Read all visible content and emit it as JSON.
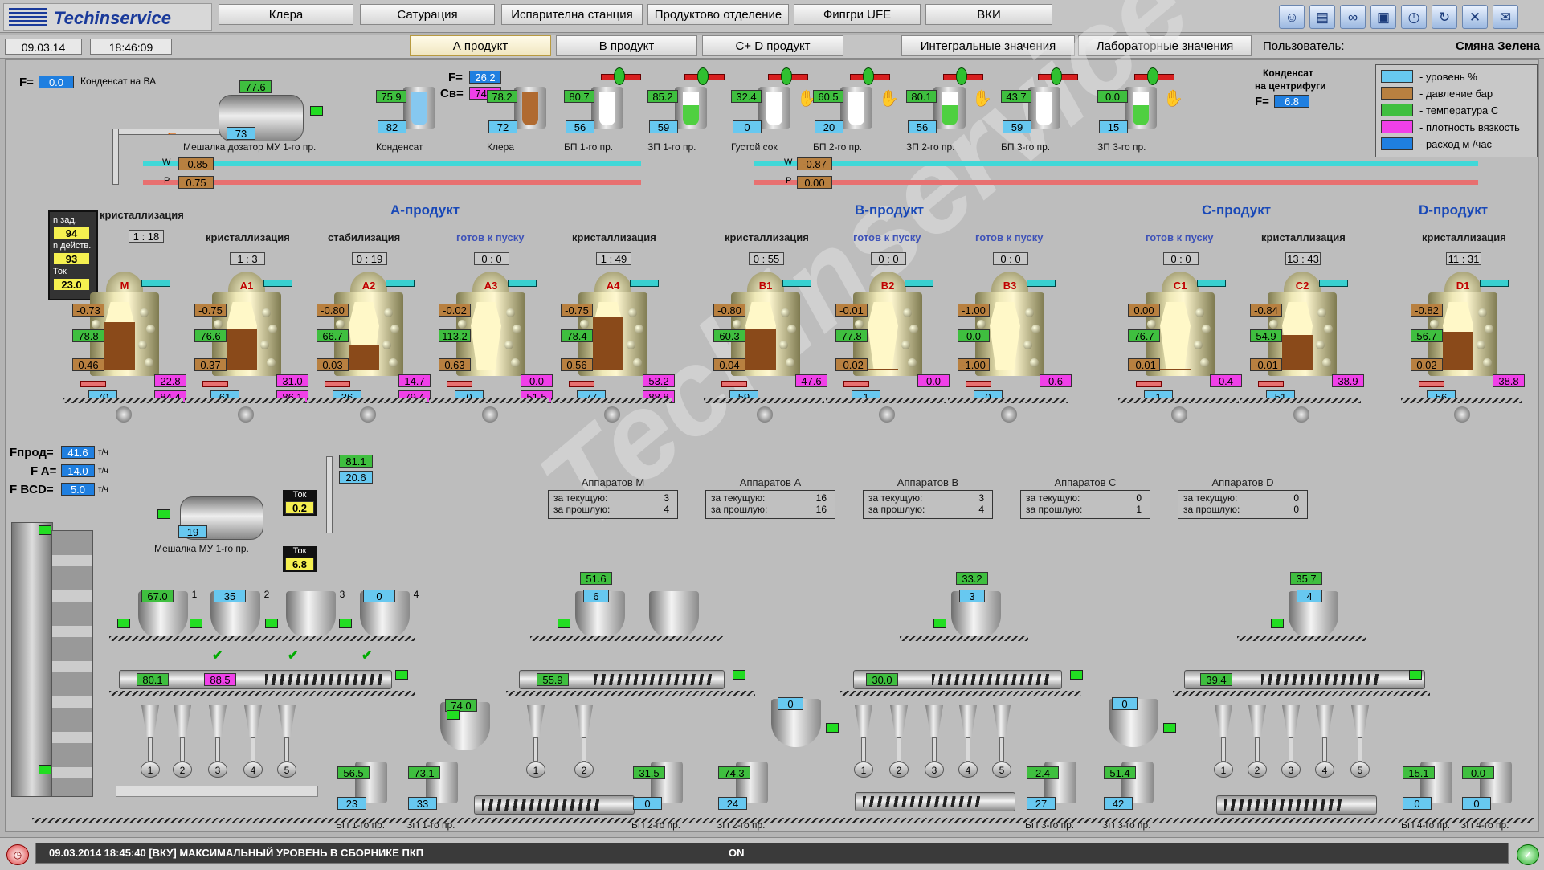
{
  "app": {
    "logo": "Techinservice",
    "watermark": "Techinservice"
  },
  "nav": {
    "row1": [
      "Клера",
      "Сатурация",
      "Испарителна станция",
      "Продуктово отделение",
      "Фипгри UFE",
      "ВКИ"
    ],
    "row2": [
      "А продукт",
      "В продукт",
      "C+ D продукт",
      "Интегральные значения",
      "Лабораторные значения"
    ],
    "active": "А продукт"
  },
  "header": {
    "date": "09.03.14",
    "time": "18:46:09",
    "user_label": "Пользователь:",
    "user": "Смяна Зелена"
  },
  "toolbar_icons": [
    "user-icon",
    "chart-icon",
    "binoculars-icon",
    "clipboard-icon",
    "alarm-clock-icon",
    "refresh-icon",
    "tools-icon",
    "message-icon"
  ],
  "colors": {
    "level": "#67c8f0",
    "pressure": "#b88040",
    "temperature": "#3fbf3f",
    "density": "#f040e8",
    "flow": "#1f7fe0"
  },
  "legend": [
    {
      "color": "#67c8f0",
      "text": "- уровень  %"
    },
    {
      "color": "#b88040",
      "text": "- давление  бар"
    },
    {
      "color": "#3fbf3f",
      "text": "- температура  С"
    },
    {
      "color": "#f040e8",
      "text": "- плотность вязкость"
    },
    {
      "color": "#1f7fe0",
      "text": "- расход  м /час"
    }
  ],
  "top": {
    "f_label": "F=",
    "f_val": "0.0",
    "f_text": "Конденсат на ВА",
    "mixer_temp": "77.6",
    "mixer_level": "73",
    "mixer_label": "Мешалка дозатор МУ 1-го пр.",
    "f2_label": "F=",
    "f2_val": "26.2",
    "cb_label": "Св=",
    "cb_val": "74.5",
    "condens_centr_label1": "Конденсат",
    "condens_centr_label2": "на центрифуги",
    "fc_label": "F=",
    "fc_val": "6.8",
    "w_label": "W",
    "w1": "-0.85",
    "p_label": "P",
    "p1": "0.75",
    "w2": "-0.87",
    "p2": "0.00"
  },
  "top_tanks": [
    {
      "name": "Конденсат",
      "temp": "75.9",
      "level": "82"
    },
    {
      "name": "Клера",
      "temp": "78.2",
      "level": "72"
    },
    {
      "name": "БП 1-го пр.",
      "temp": "80.7",
      "level": "56"
    },
    {
      "name": "ЗП 1-го пр.",
      "temp": "85.2",
      "level": "59"
    },
    {
      "name": "Густой сок",
      "temp": "32.4",
      "level": "0"
    },
    {
      "name": "БП 2-го пр.",
      "temp": "60.5",
      "level": "20"
    },
    {
      "name": "ЗП 2-го пр.",
      "temp": "80.1",
      "level": "56"
    },
    {
      "name": "БП 3-го пр.",
      "temp": "43.7",
      "level": "59"
    },
    {
      "name": "ЗП 3-го пр.",
      "temp": "0.0",
      "level": "15"
    }
  ],
  "groups": [
    {
      "name": "А-продукт"
    },
    {
      "name": "В-продукт"
    },
    {
      "name": "С-продукт"
    },
    {
      "name": "D-продукт"
    }
  ],
  "mpanel": {
    "n_zad_label": "n зад.",
    "n_zad": "94",
    "n_deist_label": "n действ.",
    "n_deist": "93",
    "tok_label": "Ток",
    "tok": "23.0",
    "state": "кристаллизация",
    "timer": "1 : 18"
  },
  "vessels": [
    {
      "name": "M",
      "state": "",
      "timer": "",
      "p": "-0.73",
      "t": "78.8",
      "p2": "0.46",
      "dens": "22.8",
      "lvl": "70",
      "visc": "84.4",
      "fill": 0.7
    },
    {
      "name": "A1",
      "state": "кристаллизация",
      "timer": "1 : 3",
      "p": "-0.75",
      "t": "76.6",
      "p2": "0.37",
      "dens": "31.0",
      "lvl": "61",
      "visc": "86.1",
      "fill": 0.61
    },
    {
      "name": "A2",
      "state": "стабилизация",
      "timer": "0 : 19",
      "p": "-0.80",
      "t": "66.7",
      "p2": "0.03",
      "dens": "14.7",
      "lvl": "36",
      "visc": "79.4",
      "fill": 0.36
    },
    {
      "name": "A3",
      "state": "готов к пуску",
      "timer": "0 : 0",
      "p": "-0.02",
      "t": "113.2",
      "p2": "0.63",
      "dens": "0.0",
      "lvl": "0",
      "visc": "51.5",
      "fill": 0
    },
    {
      "name": "A4",
      "state": "кристаллизация",
      "timer": "1 : 49",
      "p": "-0.75",
      "t": "78.4",
      "p2": "0.56",
      "dens": "53.2",
      "lvl": "77",
      "visc": "88.8",
      "fill": 0.77
    },
    {
      "name": "B1",
      "state": "кристаллизация",
      "timer": "0 : 55",
      "p": "-0.80",
      "t": "60.3",
      "p2": "0.04",
      "dens": "47.6",
      "lvl": "59",
      "visc": "",
      "fill": 0.59
    },
    {
      "name": "B2",
      "state": "готов к пуску",
      "timer": "0 : 0",
      "p": "-0.01",
      "t": "77.8",
      "p2": "-0.02",
      "dens": "0.0",
      "lvl": "1",
      "visc": "",
      "fill": 0.01
    },
    {
      "name": "B3",
      "state": "готов к пуску",
      "timer": "0 : 0",
      "p": "-1.00",
      "t": "0.0",
      "p2": "-1.00",
      "dens": "0.6",
      "lvl": "0",
      "visc": "",
      "fill": 0
    },
    {
      "name": "C1",
      "state": "готов к пуску",
      "timer": "0 : 0",
      "p": "0.00",
      "t": "76.7",
      "p2": "-0.01",
      "dens": "0.4",
      "lvl": "1",
      "visc": "",
      "fill": 0.01
    },
    {
      "name": "C2",
      "state": "кристаллизация",
      "timer": "13 : 43",
      "p": "-0.84",
      "t": "54.9",
      "p2": "-0.01",
      "dens": "38.9",
      "lvl": "51",
      "visc": "",
      "fill": 0.51
    },
    {
      "name": "D1",
      "state": "кристаллизация",
      "timer": "11 : 31",
      "p": "-0.82",
      "t": "56.7",
      "p2": "0.02",
      "dens": "38.8",
      "lvl": "56",
      "visc": "",
      "fill": 0.56
    }
  ],
  "flows": {
    "fprod_label": "Fпрод=",
    "fprod": "41.6",
    "fa_label": "F A=",
    "fa": "14.0",
    "fbcd_label": "F BCD=",
    "fbcd": "5.0",
    "unit": "т/ч"
  },
  "mixer2": {
    "label": "Мешалка МУ 1-го пр.",
    "level": "19",
    "tok_label": "Ток",
    "tok1": "0.2",
    "tok2": "6.8",
    "t": "81.1",
    "l": "20.6"
  },
  "counters": [
    {
      "title": "Аппаратов М",
      "r1": "за текущую:",
      "v1": "3",
      "r2": "за прошлую:",
      "v2": "4"
    },
    {
      "title": "Аппаратов А",
      "r1": "за текущую:",
      "v1": "16",
      "r2": "за прошлую:",
      "v2": "16"
    },
    {
      "title": "Аппаратов В",
      "r1": "за текущую:",
      "v1": "3",
      "r2": "за прошлую:",
      "v2": "4"
    },
    {
      "title": "Аппаратов С",
      "r1": "за текущую:",
      "v1": "0",
      "r2": "за прошлую:",
      "v2": "1"
    },
    {
      "title": "Аппаратов D",
      "r1": "за текущую:",
      "v1": "0",
      "r2": "за прошлую:",
      "v2": "0"
    }
  ],
  "bottom": {
    "hopperA": [
      {
        "v": "67.0",
        "n": "1"
      },
      {
        "v": "35",
        "n": "2"
      },
      {
        "v": "",
        "n": "3"
      },
      {
        "v": "0",
        "n": "4"
      }
    ],
    "screwA_t": "80.1",
    "screwA_d": "88.5",
    "hopperB_t": "51.6",
    "hopperB_l": "6",
    "screwB_t": "55.9",
    "hopperC_t": "33.2",
    "hopperC_l": "3",
    "screwC_t": "30.0",
    "hopperD_t": "35.7",
    "hopperD_l": "4",
    "screwD_t": "39.4",
    "mid1": "74.0",
    "mid2": "0",
    "mid3": "0",
    "centr": [
      "1",
      "2",
      "3",
      "4",
      "5"
    ],
    "tanks": [
      {
        "t": "56.5",
        "l": "23",
        "name": "БП 1-го пр."
      },
      {
        "t": "73.1",
        "l": "33",
        "name": "ЗП 1-го пр."
      },
      {
        "t": "31.5",
        "l": "0",
        "name": "БП 2-го пр."
      },
      {
        "t": "74.3",
        "l": "24",
        "name": "ЗП 2-го пр."
      },
      {
        "t": "2.4",
        "l": "27",
        "name": "БП 3-го пр."
      },
      {
        "t": "51.4",
        "l": "42",
        "name": "ЗП 3-го пр."
      },
      {
        "t": "15.1",
        "l": "0",
        "name": "БП 4-го пр."
      },
      {
        "t": "0.0",
        "l": "0",
        "name": "ЗП 4-го пр."
      }
    ]
  },
  "status": {
    "message": "09.03.2014 18:45:40      [ВКУ]  МАКСИМАЛЬНЫЙ УРОВЕНЬ В СБОРНИКЕ ПКП",
    "state": "ON"
  }
}
